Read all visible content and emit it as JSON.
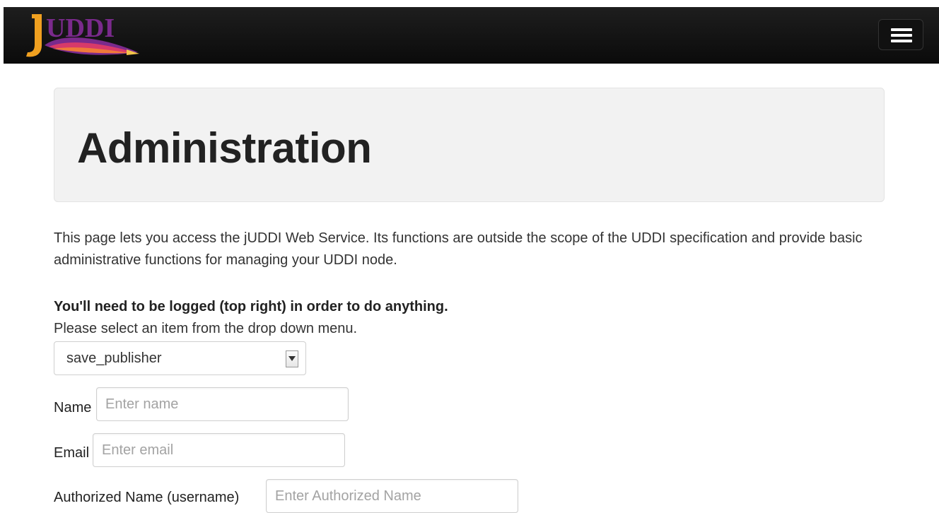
{
  "navbar": {
    "logo_text": "JUDDI",
    "menu_icon": "hamburger-icon"
  },
  "hero": {
    "title": "Administration"
  },
  "intro": "This page lets you access the jUDDI Web Service. Its functions are outside the scope of the UDDI specification and provide basic administrative functions for managing your UDDI node.",
  "warning": "You'll need to be logged (top right) in order to do anything.",
  "instruction": "Please select an item from the drop down menu.",
  "action_select": {
    "value": "save_publisher",
    "icon": "chevron-down-icon"
  },
  "form": {
    "name": {
      "label": "Name",
      "placeholder": "Enter name",
      "value": ""
    },
    "email": {
      "label": "Email",
      "placeholder": "Enter email",
      "value": ""
    },
    "authorized_name": {
      "label": "Authorized Name (username)",
      "placeholder": "Enter Authorized Name",
      "value": ""
    }
  },
  "colors": {
    "navbar": "#111111",
    "hero_bg": "#f2f2f2",
    "logo_orange": "#f0a020",
    "logo_purple": "#6a2c8a"
  }
}
